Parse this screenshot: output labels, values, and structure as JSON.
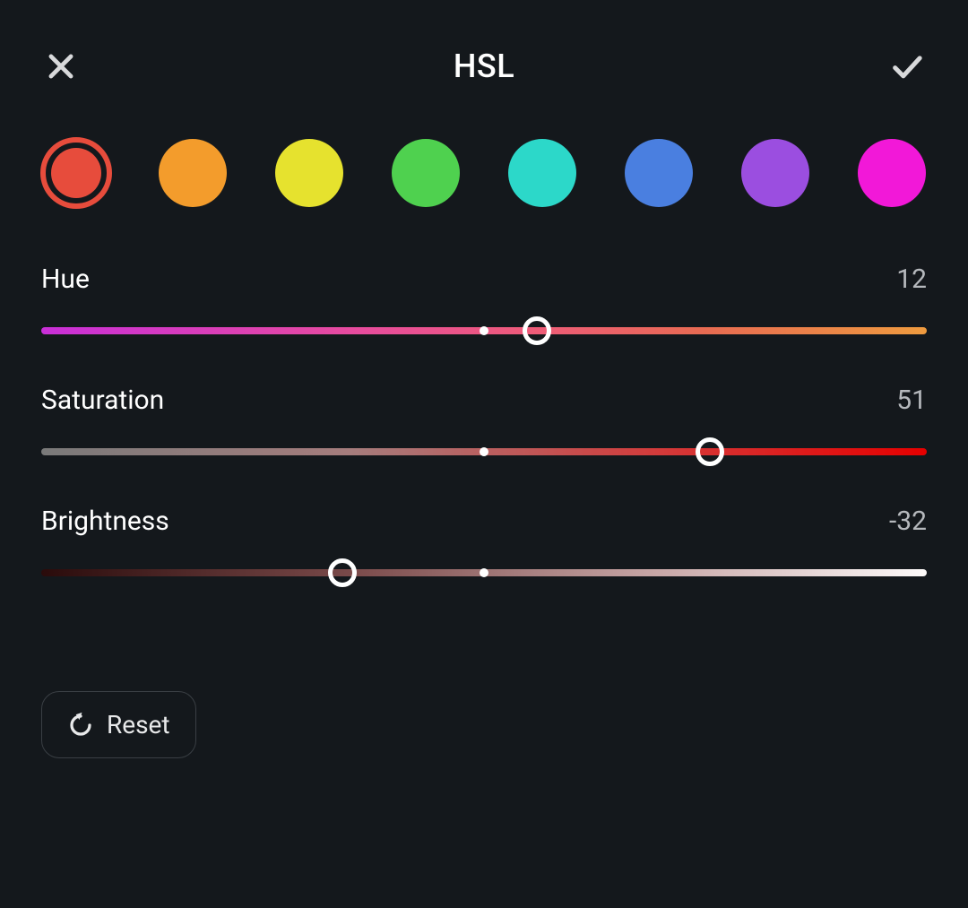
{
  "header": {
    "title": "HSL",
    "close_icon": "close-icon",
    "confirm_icon": "check-icon"
  },
  "colors": {
    "swatches": [
      {
        "name": "red",
        "hex": "#e74c3c",
        "selected": true
      },
      {
        "name": "orange",
        "hex": "#f39c2c",
        "selected": false
      },
      {
        "name": "yellow",
        "hex": "#e6e22e",
        "selected": false
      },
      {
        "name": "green",
        "hex": "#4fd14f",
        "selected": false
      },
      {
        "name": "cyan",
        "hex": "#2cd8c9",
        "selected": false
      },
      {
        "name": "blue",
        "hex": "#4a7fe0",
        "selected": false
      },
      {
        "name": "purple",
        "hex": "#9b4ee0",
        "selected": false
      },
      {
        "name": "magenta",
        "hex": "#f218d8",
        "selected": false
      }
    ]
  },
  "sliders": {
    "hue": {
      "label": "Hue",
      "value": 12,
      "min": -100,
      "max": 100
    },
    "saturation": {
      "label": "Saturation",
      "value": 51,
      "min": -100,
      "max": 100
    },
    "brightness": {
      "label": "Brightness",
      "value": -32,
      "min": -100,
      "max": 100
    }
  },
  "reset": {
    "label": "Reset"
  }
}
